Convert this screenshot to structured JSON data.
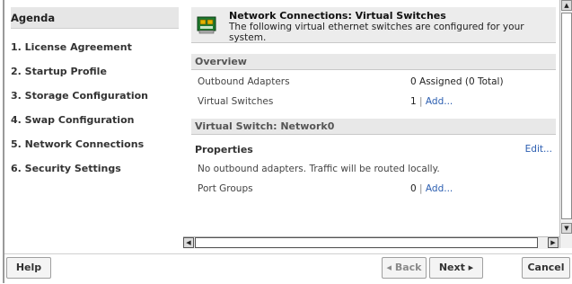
{
  "agenda": {
    "header": "Agenda",
    "items": [
      {
        "label": "1. License Agreement"
      },
      {
        "label": "2. Startup Profile"
      },
      {
        "label": "3. Storage Configuration"
      },
      {
        "label": "4. Swap Configuration"
      },
      {
        "label": "5. Network Connections"
      },
      {
        "label": "6. Security Settings"
      }
    ]
  },
  "main": {
    "title": "Network Connections: Virtual Switches",
    "description": "The following virtual ethernet switches are configured for your system.",
    "overview": {
      "header": "Overview",
      "rows": [
        {
          "label": "Outbound Adapters",
          "value": "0 Assigned (0 Total)"
        },
        {
          "label": "Virtual Switches",
          "value": "1",
          "link": "Add..."
        }
      ]
    },
    "switch": {
      "header": "Virtual Switch: Network0",
      "properties_label": "Properties",
      "edit_link": "Edit...",
      "note": "No outbound adapters. Traffic will be routed locally.",
      "port_groups": {
        "label": "Port Groups",
        "value": "0",
        "link": "Add..."
      }
    }
  },
  "footer": {
    "help": "Help",
    "back": "◂ Back",
    "next": "Next ▸",
    "cancel": "Cancel"
  },
  "icons": {
    "network": "network-card-icon"
  }
}
